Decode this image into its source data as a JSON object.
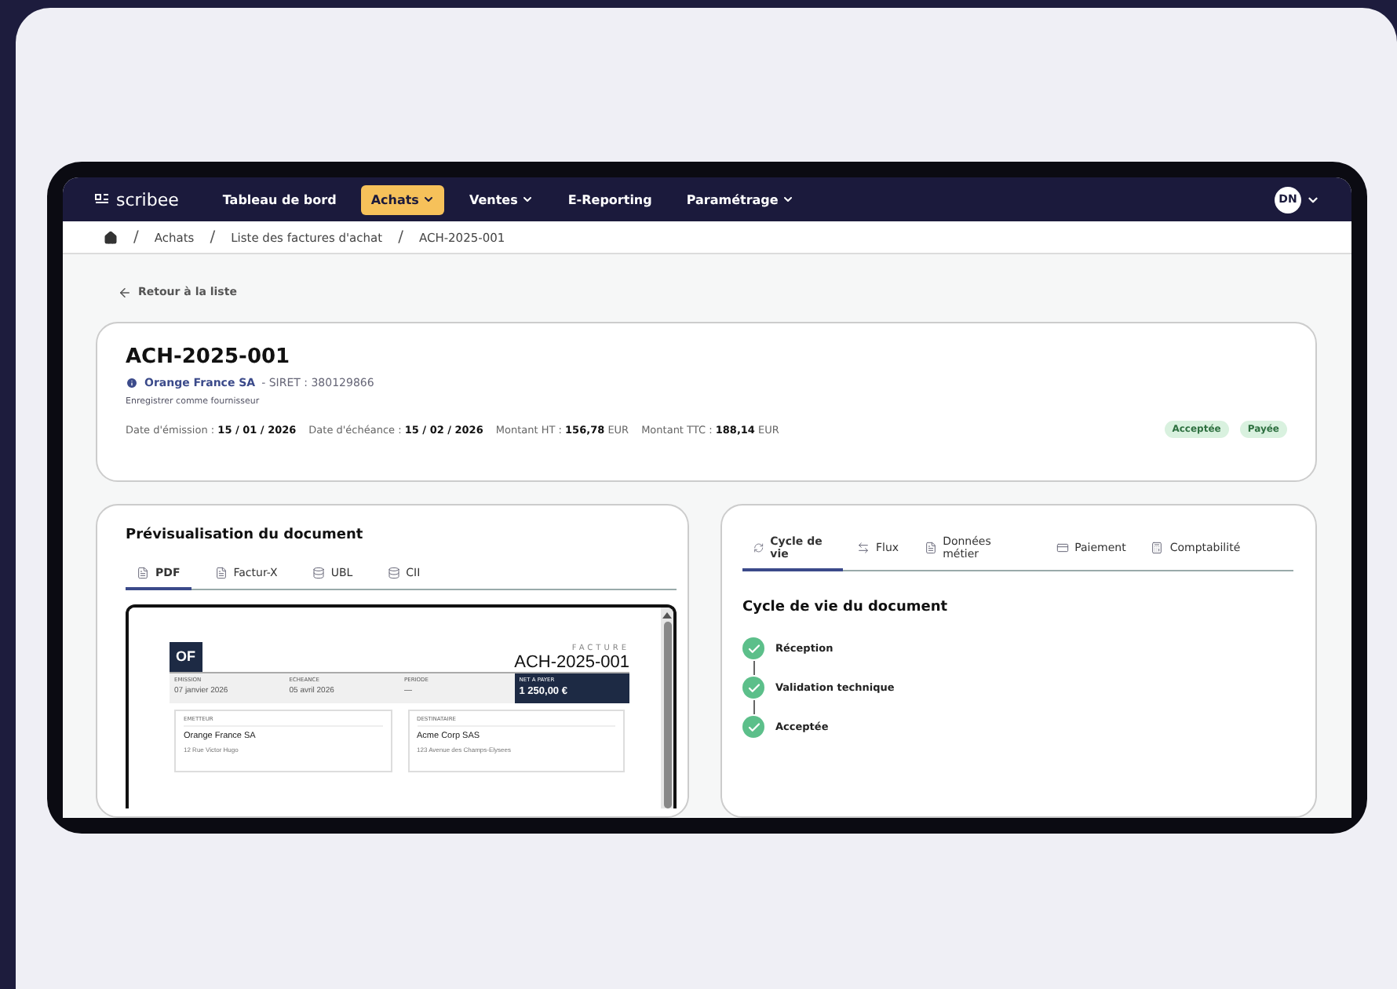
{
  "nav": {
    "logo": "scribee",
    "items": [
      {
        "label": "Tableau de bord",
        "selected": false,
        "dropdown": false
      },
      {
        "label": "Achats",
        "selected": true,
        "dropdown": true
      },
      {
        "label": "Ventes",
        "selected": false,
        "dropdown": true
      },
      {
        "label": "E-Reporting",
        "selected": false,
        "dropdown": false
      },
      {
        "label": "Paramétrage",
        "selected": false,
        "dropdown": true
      }
    ],
    "avatar": "DN"
  },
  "breadcrumb": [
    {
      "separator": "/",
      "label": "Achats"
    },
    {
      "separator": "/",
      "label": "Liste des factures d'achat"
    },
    {
      "separator": "/",
      "label": "ACH-2025-001"
    }
  ],
  "back_link": "Retour à la liste",
  "header": {
    "title": "ACH-2025-001",
    "supplier": "Orange France SA",
    "siret": "- SIRET : 380129866",
    "register_link": "Enregistrer comme fournisseur",
    "facts": [
      {
        "label": "Date d'émission :",
        "value": "15 / 01 / 2026"
      },
      {
        "label": "Date d'échéance :",
        "value": "15 / 02 / 2026"
      },
      {
        "label": "Montant HT :",
        "value": "156,78",
        "unit": "EUR"
      },
      {
        "label": "Montant TTC :",
        "value": "188,14",
        "unit": "EUR"
      }
    ],
    "badges": [
      "Acceptée",
      "Payée"
    ]
  },
  "preview": {
    "title": "Prévisualisation du document",
    "tabs": [
      {
        "label": "PDF",
        "kind": "file",
        "selected": true
      },
      {
        "label": "Factur-X",
        "kind": "file",
        "selected": false
      },
      {
        "label": "UBL",
        "kind": "database",
        "selected": false
      },
      {
        "label": "CII",
        "kind": "database",
        "selected": false
      }
    ],
    "document": {
      "logo": "OF",
      "doc_type": "FACTURE",
      "number": "ACH-2025-001",
      "meta": [
        {
          "label": "EMISSION",
          "value": "07 janvier 2026",
          "highlight": false
        },
        {
          "label": "ECHEANCE",
          "value": "05 avril 2026",
          "highlight": false
        },
        {
          "label": "PERIODE",
          "value": "—",
          "highlight": false
        },
        {
          "label": "NET A PAYER",
          "value": "1 250,00 €",
          "highlight": true
        }
      ],
      "parties": [
        {
          "label": "EMETTEUR",
          "name": "Orange France SA",
          "address": "12 Rue Victor Hugo"
        },
        {
          "label": "DESTINATAIRE",
          "name": "Acme Corp SAS",
          "address": "123 Avenue des Champs-Elysees"
        }
      ]
    }
  },
  "details": {
    "tabs": [
      {
        "label": "Cycle de vie",
        "kind": "cycle",
        "selected": true
      },
      {
        "label": "Flux",
        "kind": "arrows",
        "selected": false
      },
      {
        "label": "Données métier",
        "kind": "file",
        "selected": false
      },
      {
        "label": "Paiement",
        "kind": "card",
        "selected": false
      },
      {
        "label": "Comptabilité",
        "kind": "calc",
        "selected": false
      }
    ],
    "title": "Cycle de vie du document",
    "steps": [
      {
        "label": "Réception",
        "done": true
      },
      {
        "label": "Validation technique",
        "done": true
      },
      {
        "label": "Acceptée",
        "done": true
      }
    ]
  }
}
